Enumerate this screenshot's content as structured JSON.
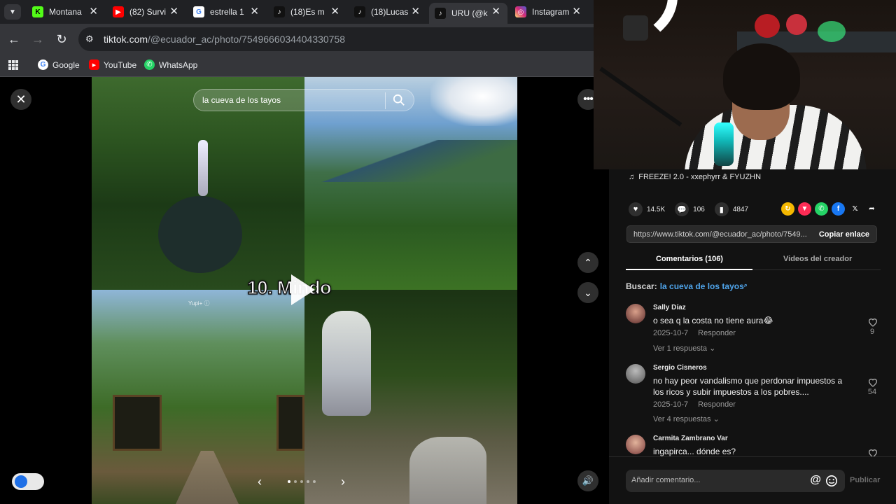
{
  "browser": {
    "tabs": [
      {
        "title": "Montana",
        "favicon": "K",
        "color": "#53fc18"
      },
      {
        "title": "(82) Survi",
        "favicon": "youtube-icon",
        "color": "#ff0000"
      },
      {
        "title": "estrella 1",
        "favicon": "google-icon",
        "color": "#4285f4"
      },
      {
        "title": "(18)Es m",
        "favicon": "tiktok-icon",
        "color": "#111111"
      },
      {
        "title": "(18)Lucas",
        "favicon": "tiktok-icon",
        "color": "#111111"
      },
      {
        "title": "URU (@k",
        "favicon": "tiktok-icon",
        "color": "#111111"
      },
      {
        "title": "Instagram",
        "favicon": "instagram-icon",
        "color": "#d62976"
      }
    ],
    "url_host": "tiktok.com",
    "url_path": "/@ecuador_ac/photo/7549666034404330758",
    "bookmarks": [
      {
        "label": "Google"
      },
      {
        "label": "YouTube"
      },
      {
        "label": "WhatsApp"
      }
    ]
  },
  "viewer": {
    "search_overlay": "la cueva de los tayos",
    "caption": "10. Mindo",
    "watermark": "Yupi+ ⓘ"
  },
  "panel": {
    "music": "FREEZE! 2.0 - xxephyrr & FYUZHN",
    "likes": "14.5K",
    "comments": "106",
    "saves": "4847",
    "link": "https://www.tiktok.com/@ecuador_ac/photo/7549...",
    "copy_label": "Copiar enlace",
    "tab_comments": "Comentarios (106)",
    "tab_creator": "Videos del creador",
    "search_label": "Buscar:",
    "search_term": "la cueva de los tayos",
    "comment_list": [
      {
        "name": "Sally Díaz",
        "text": "o sea q la costa no tiene aura😂",
        "date": "2025-10-7",
        "reply": "Responder",
        "replies": "Ver 1 respuesta",
        "likes": "9"
      },
      {
        "name": "Sergio Cisneros",
        "text": "no hay peor vandalismo que perdonar impuestos a los ricos y subir impuestos a los pobres....",
        "date": "2025-10-7",
        "reply": "Responder",
        "replies": "Ver 4 respuestas",
        "likes": "54"
      },
      {
        "name": "Carmita Zambrano Var",
        "text": "ingapirca... dónde es?",
        "date": "",
        "reply": "",
        "replies": "",
        "likes": ""
      }
    ],
    "add_comment_placeholder": "Añadir comentario...",
    "publish_label": "Publicar"
  }
}
